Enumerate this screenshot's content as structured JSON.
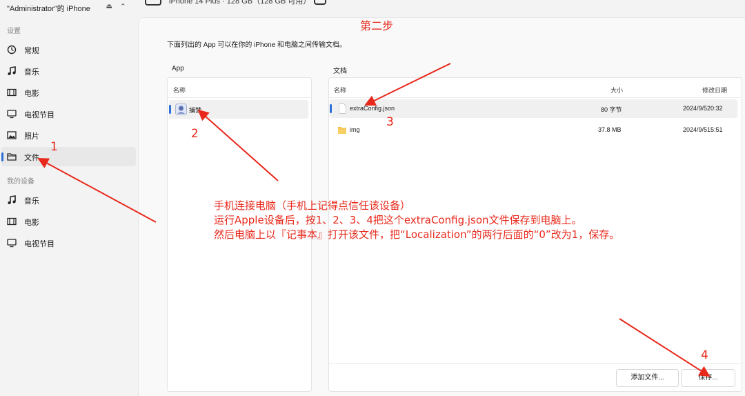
{
  "sidebar": {
    "device_name": "\"Administrator\"的 iPhone",
    "section_settings": "设置",
    "settings_items": [
      {
        "label": "常规",
        "icon": "general-icon"
      },
      {
        "label": "音乐",
        "icon": "music-icon"
      },
      {
        "label": "电影",
        "icon": "film-icon"
      },
      {
        "label": "电视节目",
        "icon": "tv-icon"
      },
      {
        "label": "照片",
        "icon": "photo-icon"
      },
      {
        "label": "文件",
        "icon": "folder-icon",
        "selected": true
      }
    ],
    "section_my_devices": "我的设备",
    "device_items": [
      {
        "label": "音乐",
        "icon": "music-icon"
      },
      {
        "label": "电影",
        "icon": "film-icon"
      },
      {
        "label": "电视节目",
        "icon": "tv-icon"
      }
    ]
  },
  "topbar": {
    "device_info": "iPhone 14 Plus · 128 GB（128 GB 可用）"
  },
  "main": {
    "description": "下面列出的 App 可以在你的 iPhone 和电脑之间传输文档。",
    "app_column_title": "App",
    "app_header_name": "名称",
    "apps": [
      {
        "name": "捕梦",
        "selected": true
      }
    ],
    "docs_column_title": "文档",
    "docs_headers": {
      "name": "名称",
      "size": "大小",
      "modified": "修改日期"
    },
    "files": [
      {
        "name": "extraConfig.json",
        "size": "80 字节",
        "modified": "2024/9/520:32",
        "type": "file",
        "selected": true
      },
      {
        "name": "img",
        "size": "37.8 MB",
        "modified": "2024/9/515:51",
        "type": "folder"
      }
    ],
    "add_file_button": "添加文件...",
    "save_button": "保存..."
  },
  "annotations": {
    "step_title": "第二步",
    "step1": "1",
    "step2": "2",
    "step3": "3",
    "step4": "4",
    "note_line1": "手机连接电脑（手机上记得点信任该设备）",
    "note_line2": "运行Apple设备后，按1、2、3、4把这个extraConfig.json文件保存到电脑上。",
    "note_line3": "然后电脑上以『记事本』打开该文件，把“Localization”的两行后面的“0”改为1，保存。",
    "color": "#e8281b"
  },
  "theme": {
    "accent": "#2a6fd6"
  }
}
